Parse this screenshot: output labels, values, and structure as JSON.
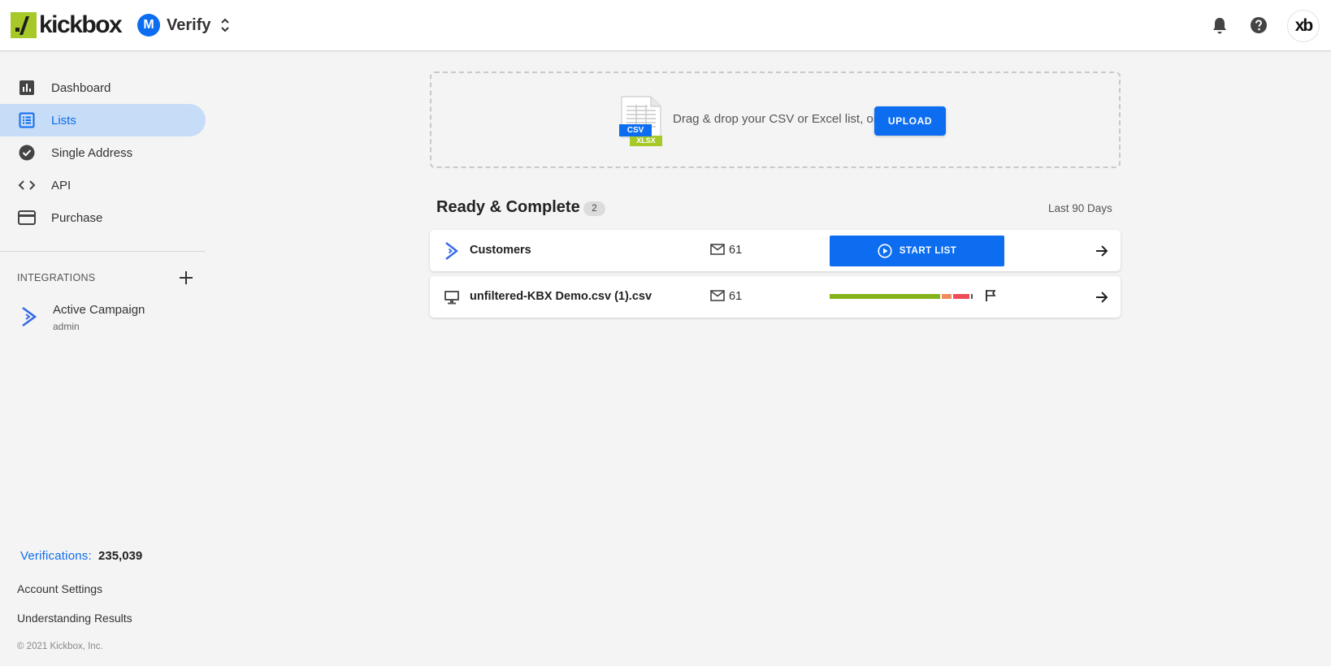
{
  "header": {
    "logo_text": "kickbox",
    "app_initial": "M",
    "app_name": "Verify"
  },
  "sidebar": {
    "items": [
      {
        "label": "Dashboard",
        "icon": "bar-chart-icon"
      },
      {
        "label": "Lists",
        "icon": "list-icon",
        "active": true
      },
      {
        "label": "Single Address",
        "icon": "check-circle-icon"
      },
      {
        "label": "API",
        "icon": "code-icon"
      },
      {
        "label": "Purchase",
        "icon": "credit-card-icon"
      }
    ],
    "integrations_header": "INTEGRATIONS",
    "integration": {
      "name": "Active Campaign",
      "sub": "admin"
    },
    "verifications_label": "Verifications:",
    "verifications_value": "235,039",
    "account_settings": "Account Settings",
    "understanding_results": "Understanding Results",
    "copyright": "© 2021 Kickbox, Inc."
  },
  "upload": {
    "text": "Drag & drop your CSV or Excel list, or",
    "button": "UPLOAD",
    "file_icon_csv": "CSV",
    "file_icon_xlsx": "XLSX"
  },
  "section": {
    "title": "Ready & Complete",
    "count": "2",
    "range": "Last 90 Days"
  },
  "lists": [
    {
      "name": "Customers",
      "source": "active-campaign-icon",
      "count": "61",
      "action": "START LIST"
    },
    {
      "name": "unfiltered-KBX Demo.csv (1).csv",
      "source": "computer-icon",
      "count": "61",
      "progress": [
        {
          "label": "deliverable",
          "fraction": 0.8,
          "color": "#84b31a"
        },
        {
          "label": "risky",
          "fraction": 0.07,
          "color": "#f28b5c"
        },
        {
          "label": "undeliverable",
          "fraction": 0.12,
          "color": "#ee4d57"
        },
        {
          "label": "unknown",
          "fraction": 0.01,
          "color": "#555555"
        }
      ]
    }
  ],
  "colors": {
    "accent": "#0c6df0",
    "brand": "#a6c929",
    "active_nav_bg": "#c7dcf6"
  }
}
